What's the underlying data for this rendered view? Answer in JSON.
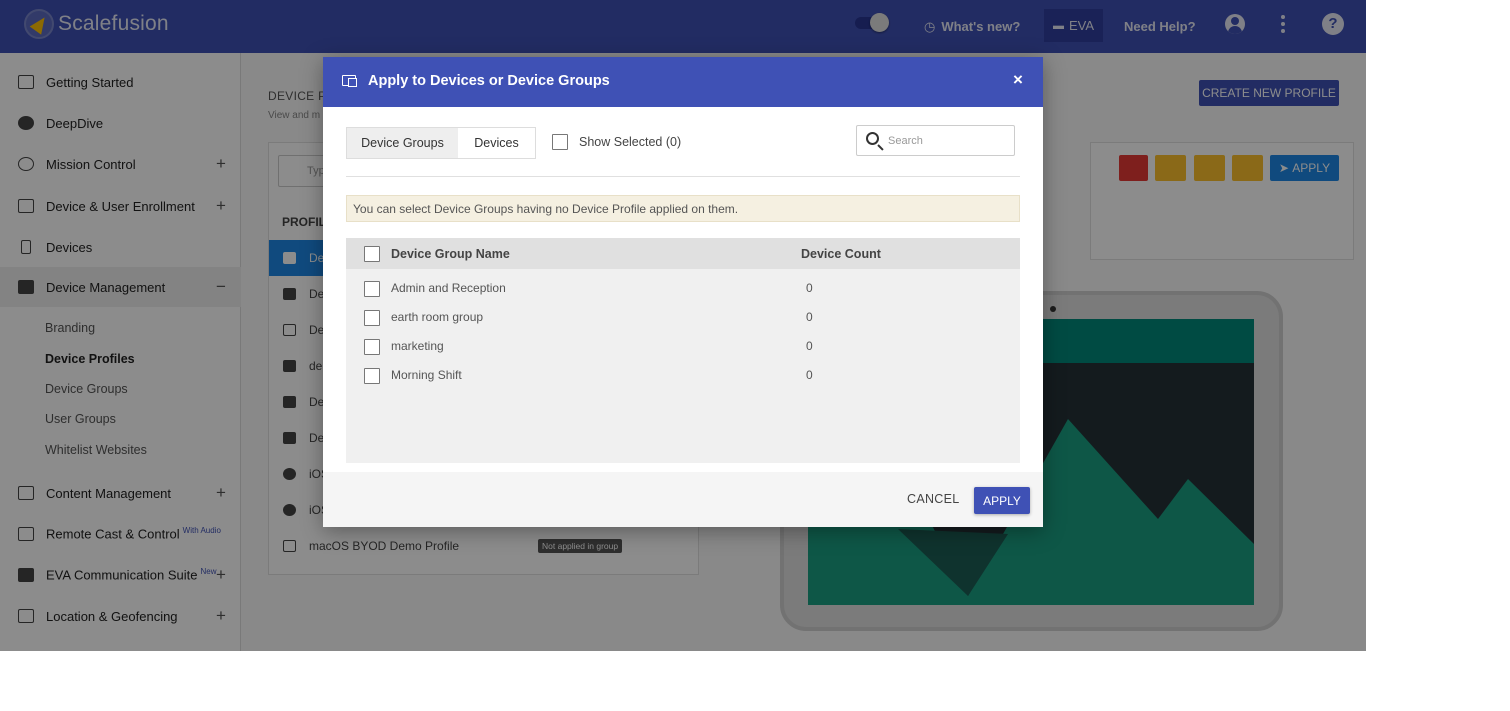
{
  "topbar": {
    "brand": "Scalefusion",
    "whats_new": "What's new?",
    "eva": "EVA",
    "need_help": "Need Help?"
  },
  "sidebar": {
    "items": [
      {
        "label": "Getting Started",
        "icon": "sign-in-icon",
        "expandable": false
      },
      {
        "label": "DeepDive",
        "icon": "speedometer-icon",
        "expandable": false
      },
      {
        "label": "Mission Control",
        "icon": "globe-icon",
        "expandable": true
      },
      {
        "label": "Device & User Enrollment",
        "icon": "devices-icon",
        "expandable": true
      },
      {
        "label": "Devices",
        "icon": "phone-icon",
        "expandable": false
      },
      {
        "label": "Device Management",
        "icon": "briefcase-icon",
        "expandable": true,
        "expanded": true
      },
      {
        "label": "Content Management",
        "icon": "folder-icon",
        "expandable": true
      },
      {
        "label": "Remote Cast & Control",
        "icon": "cast-icon",
        "expandable": false,
        "tag": "With Audio"
      },
      {
        "label": "EVA Communication Suite",
        "icon": "chat-icon",
        "expandable": true,
        "tag": "New"
      },
      {
        "label": "Location & Geofencing",
        "icon": "map-icon",
        "expandable": true
      }
    ],
    "sub_items": [
      "Branding",
      "Device Profiles",
      "Device Groups",
      "User Groups",
      "Whitelist Websites"
    ],
    "active_sub": "Device Profiles"
  },
  "main": {
    "title": "DEVICE PO",
    "subtitle": "View and m",
    "create_button": "CREATE NEW PROFILE",
    "search_placeholder": "Typ",
    "list_header": "PROFILE",
    "profiles": [
      {
        "name": "Dem",
        "icon": "android-icon",
        "selected": true
      },
      {
        "name": "Dem",
        "icon": "android-icon"
      },
      {
        "name": "De",
        "icon": "laptop-icon"
      },
      {
        "name": "den",
        "icon": "android-icon"
      },
      {
        "name": "Dem",
        "icon": "android-icon"
      },
      {
        "name": "Dem",
        "icon": "android-icon"
      },
      {
        "name": "iOS",
        "icon": "apple-icon"
      },
      {
        "name": "iOS",
        "icon": "apple-icon"
      },
      {
        "name": "macOS BYOD Demo Profile",
        "icon": "laptop-icon",
        "badge": "Not applied in group"
      }
    ],
    "apply_button": "APPLY",
    "action_colors": {
      "delete": "#e53935",
      "schedule": "#fbc02d",
      "copy": "#fbc02d",
      "edit": "#fbc02d",
      "apply": "#1e88e5"
    }
  },
  "modal": {
    "title": "Apply to Devices or Device Groups",
    "close": "×",
    "tabs": [
      "Device Groups",
      "Devices"
    ],
    "active_tab": "Device Groups",
    "show_selected": "Show Selected (0)",
    "search_placeholder": "Search",
    "notice": "You can select Device Groups having no Device Profile applied on them.",
    "columns": [
      "Device Group Name",
      "Device Count"
    ],
    "rows": [
      {
        "name": "Admin and Reception",
        "count": "0"
      },
      {
        "name": "earth room group",
        "count": "0"
      },
      {
        "name": "marketing",
        "count": "0"
      },
      {
        "name": "Morning Shift",
        "count": "0"
      }
    ],
    "cancel": "CANCEL",
    "apply": "APPLY"
  },
  "colors": {
    "primary": "#3f51b5",
    "apply_blue": "#1e88e5",
    "notice_bg": "#f5f0e1"
  }
}
